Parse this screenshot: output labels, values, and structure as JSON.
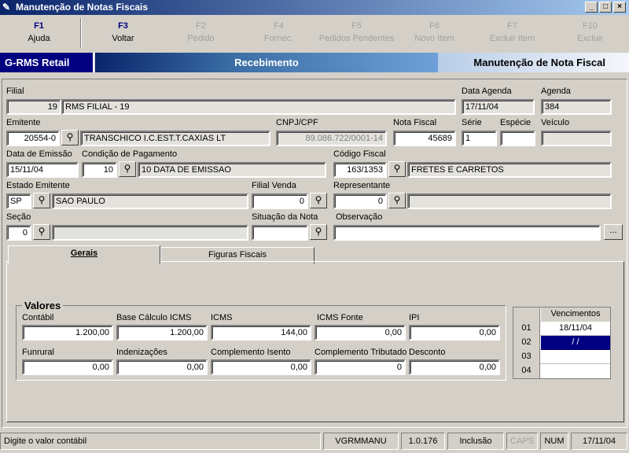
{
  "window": {
    "title": "Manutenção de Notas Fiscais",
    "controls": [
      "_",
      "□",
      "×"
    ]
  },
  "fkeys": [
    {
      "key": "F1",
      "label": "Ajuda",
      "enabled": true
    },
    {
      "key": "F3",
      "label": "Voltar",
      "enabled": true
    },
    {
      "key": "F2",
      "label": "Pedido",
      "enabled": false
    },
    {
      "key": "F4",
      "label": "Fornec.",
      "enabled": false
    },
    {
      "key": "F5",
      "label": "Pedidos Pendentes",
      "enabled": false
    },
    {
      "key": "F6",
      "label": "Novo Item",
      "enabled": false
    },
    {
      "key": "F7",
      "label": "Excluir Item",
      "enabled": false
    },
    {
      "key": "F10",
      "label": "Excluir",
      "enabled": false
    }
  ],
  "banner": {
    "app": "G-RMS Retail",
    "module": "Recebimento",
    "screen": "Manutenção de Nota Fiscal"
  },
  "form": {
    "filial": {
      "label": "Filial",
      "code": "19",
      "name": "RMS FILIAL - 19"
    },
    "data_agenda": {
      "label": "Data Agenda",
      "value": "17/11/04"
    },
    "agenda": {
      "label": "Agenda",
      "value": "384"
    },
    "emitente": {
      "label": "Emitente",
      "code": "20554-0",
      "name": "TRANSCHICO I.C.EST.T.CAXIAS LT"
    },
    "cnpj": {
      "label": "CNPJ/CPF",
      "value": "89.086.722/0001-14"
    },
    "nota_fiscal": {
      "label": "Nota Fiscal",
      "value": "45689"
    },
    "serie": {
      "label": "Série",
      "value": "1"
    },
    "especie": {
      "label": "Espécie",
      "value": ""
    },
    "veiculo": {
      "label": "Veículo",
      "value": ""
    },
    "data_emissao": {
      "label": "Data de Emissão",
      "value": "15/11/04"
    },
    "condicao_pagamento": {
      "label": "Condição de Pagamento",
      "code": "10",
      "desc": "10 DATA DE EMISSAO"
    },
    "codigo_fiscal": {
      "label": "Código Fiscal",
      "code": "163/1353",
      "desc": "FRETES E CARRETOS"
    },
    "estado_emitente": {
      "label": "Estado Emitente",
      "code": "SP",
      "name": "SAO PAULO"
    },
    "filial_venda": {
      "label": "Filial Venda",
      "value": "0"
    },
    "representante": {
      "label": "Representante",
      "code": "0",
      "name": ""
    },
    "secao": {
      "label": "Seção",
      "code": "0",
      "name": ""
    },
    "situacao_nota": {
      "label": "Situação da Nota",
      "value": ""
    },
    "observacao": {
      "label": "Observação",
      "value": "",
      "button": "..."
    }
  },
  "tabs": [
    {
      "label": "Gerais",
      "active": true
    },
    {
      "label": "Figuras Fiscais",
      "active": false
    }
  ],
  "valores": {
    "title": "Valores",
    "contabil": {
      "label": "Contábil",
      "value": "1.200,00"
    },
    "base_icms": {
      "label": "Base Cálculo ICMS",
      "value": "1.200,00"
    },
    "icms": {
      "label": "ICMS",
      "value": "144,00"
    },
    "icms_fonte": {
      "label": "ICMS Fonte",
      "value": "0,00"
    },
    "ipi": {
      "label": "IPI",
      "value": "0,00"
    },
    "funrural": {
      "label": "Funrural",
      "value": "0,00"
    },
    "indenizacoes": {
      "label": "Indenizações",
      "value": "0,00"
    },
    "complemento_isento": {
      "label": "Complemento Isento",
      "value": "0,00"
    },
    "complemento_tributado": {
      "label": "Complemento Tributado",
      "value": "0"
    },
    "desconto": {
      "label": "Desconto",
      "value": "0,00"
    }
  },
  "vencimentos": {
    "header": "Vencimentos",
    "rows": [
      {
        "num": "01",
        "value": "18/11/04",
        "selected": false
      },
      {
        "num": "02",
        "value": "/ /",
        "selected": true
      },
      {
        "num": "03",
        "value": "",
        "selected": false
      },
      {
        "num": "04",
        "value": "",
        "selected": false
      }
    ]
  },
  "status": {
    "message": "Digite o valor contábil",
    "user": "VGRMMANU",
    "version": "1.0.176",
    "mode": "Inclusão",
    "caps": "CAPS",
    "num": "NUM",
    "date": "17/11/04"
  }
}
